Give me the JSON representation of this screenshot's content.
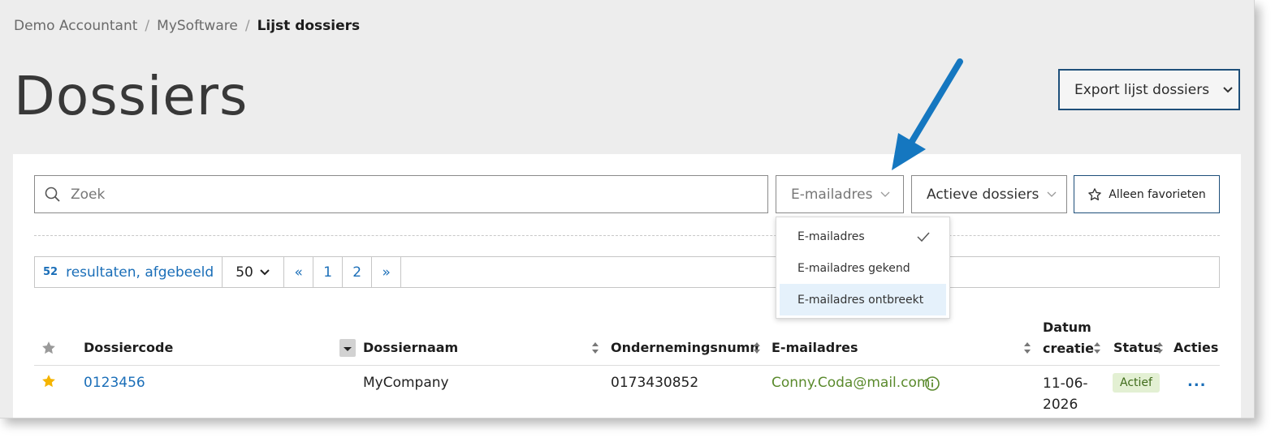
{
  "breadcrumb": {
    "items": [
      "Demo Accountant",
      "MySoftware"
    ],
    "separator": "/",
    "current": "Lijst dossiers"
  },
  "page": {
    "title": "Dossiers"
  },
  "export_button": {
    "label": "Export lijst dossiers"
  },
  "search": {
    "placeholder": "Zoek",
    "value": ""
  },
  "filters": {
    "email": {
      "label": "E-mailadres"
    },
    "status": {
      "label": "Actieve dossiers"
    },
    "favorites": {
      "label": "Alleen favorieten"
    }
  },
  "email_dropdown": {
    "options": [
      "E-mailadres",
      "E-mailadres gekend",
      "E-mailadres ontbreekt"
    ],
    "selected": "E-mailadres",
    "highlighted": "E-mailadres ontbreekt"
  },
  "pagination": {
    "count": "52",
    "results_label": "resultaten, afgebeeld",
    "per_page": "50",
    "first": "«",
    "pages": [
      "1",
      "2"
    ],
    "last": "»"
  },
  "table": {
    "headers": {
      "code": "Dossiercode",
      "name": "Dossiernaam",
      "company_number": "Ondernemingsnummer",
      "email": "E-mailadres",
      "date_line1": "Datum",
      "date_line2": "creatie",
      "status": "Status",
      "actions": "Acties"
    },
    "rows": [
      {
        "favorite": true,
        "code": "0123456",
        "name": "MyCompany",
        "company_number": "0173430852",
        "email": "Conny.Coda@mail.com",
        "date_line1": "11-06-",
        "date_line2": "2026",
        "status": "Actief",
        "actions": "..."
      }
    ]
  },
  "colors": {
    "link": "#1a6eb8",
    "email": "#5a8a2c",
    "badge_bg": "#e3f0d3",
    "badge_text": "#3f6b1a",
    "arrow": "#1577c0",
    "star_active": "#f5b400",
    "star_inactive": "#9a9a9a",
    "button_border": "#1e4f7a"
  },
  "icons": [
    "search-icon",
    "chevron-down-icon",
    "star-outline-icon",
    "star-filled-icon",
    "checkmark-icon",
    "info-icon",
    "sort-icon",
    "annotation-arrow"
  ]
}
